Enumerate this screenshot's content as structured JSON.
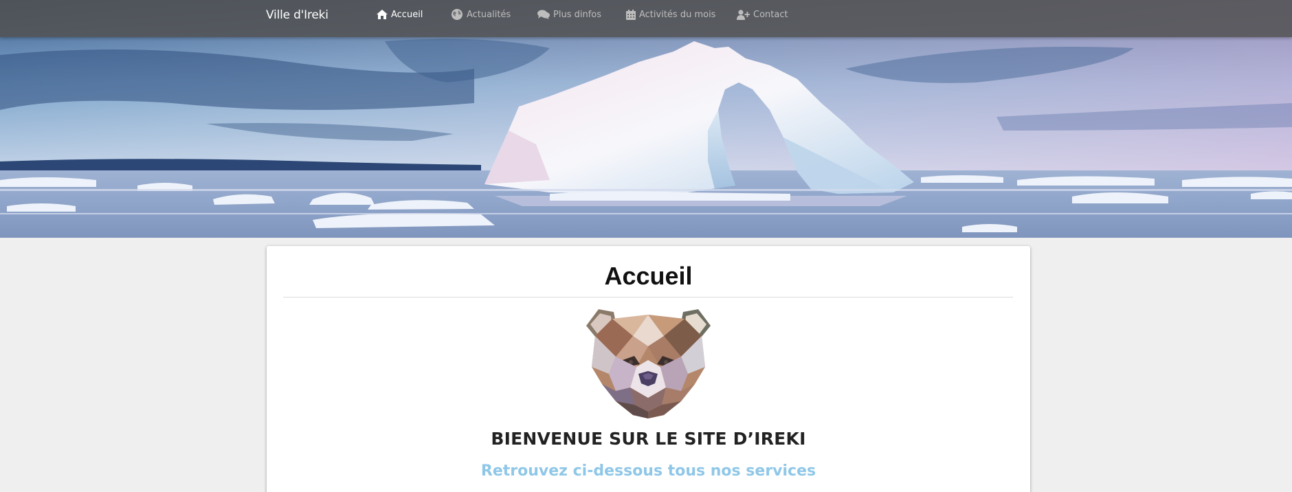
{
  "nav": {
    "brand": "Ville d'Ireki",
    "items": [
      {
        "label": "Accueil",
        "icon": "home-icon",
        "active": true
      },
      {
        "label": "Actualités",
        "icon": "globe-icon",
        "active": false
      },
      {
        "label": "Plus dinfos",
        "icon": "comments-icon",
        "active": false
      },
      {
        "label": "Activités du mois",
        "icon": "calendar-icon",
        "active": false
      },
      {
        "label": "Contact",
        "icon": "user-plus-icon",
        "active": false
      }
    ]
  },
  "page": {
    "title": "Accueil",
    "welcome": "BIENVENUE SUR LE SITE D’IREKI",
    "services": "Retrouvez ci-dessous tous nos services"
  },
  "colors": {
    "navbar": "#525252",
    "nav_active": "#ffffff",
    "nav_inactive": "#bdbdbd",
    "services_text": "#8fc7e8",
    "page_background": "#efefef"
  }
}
